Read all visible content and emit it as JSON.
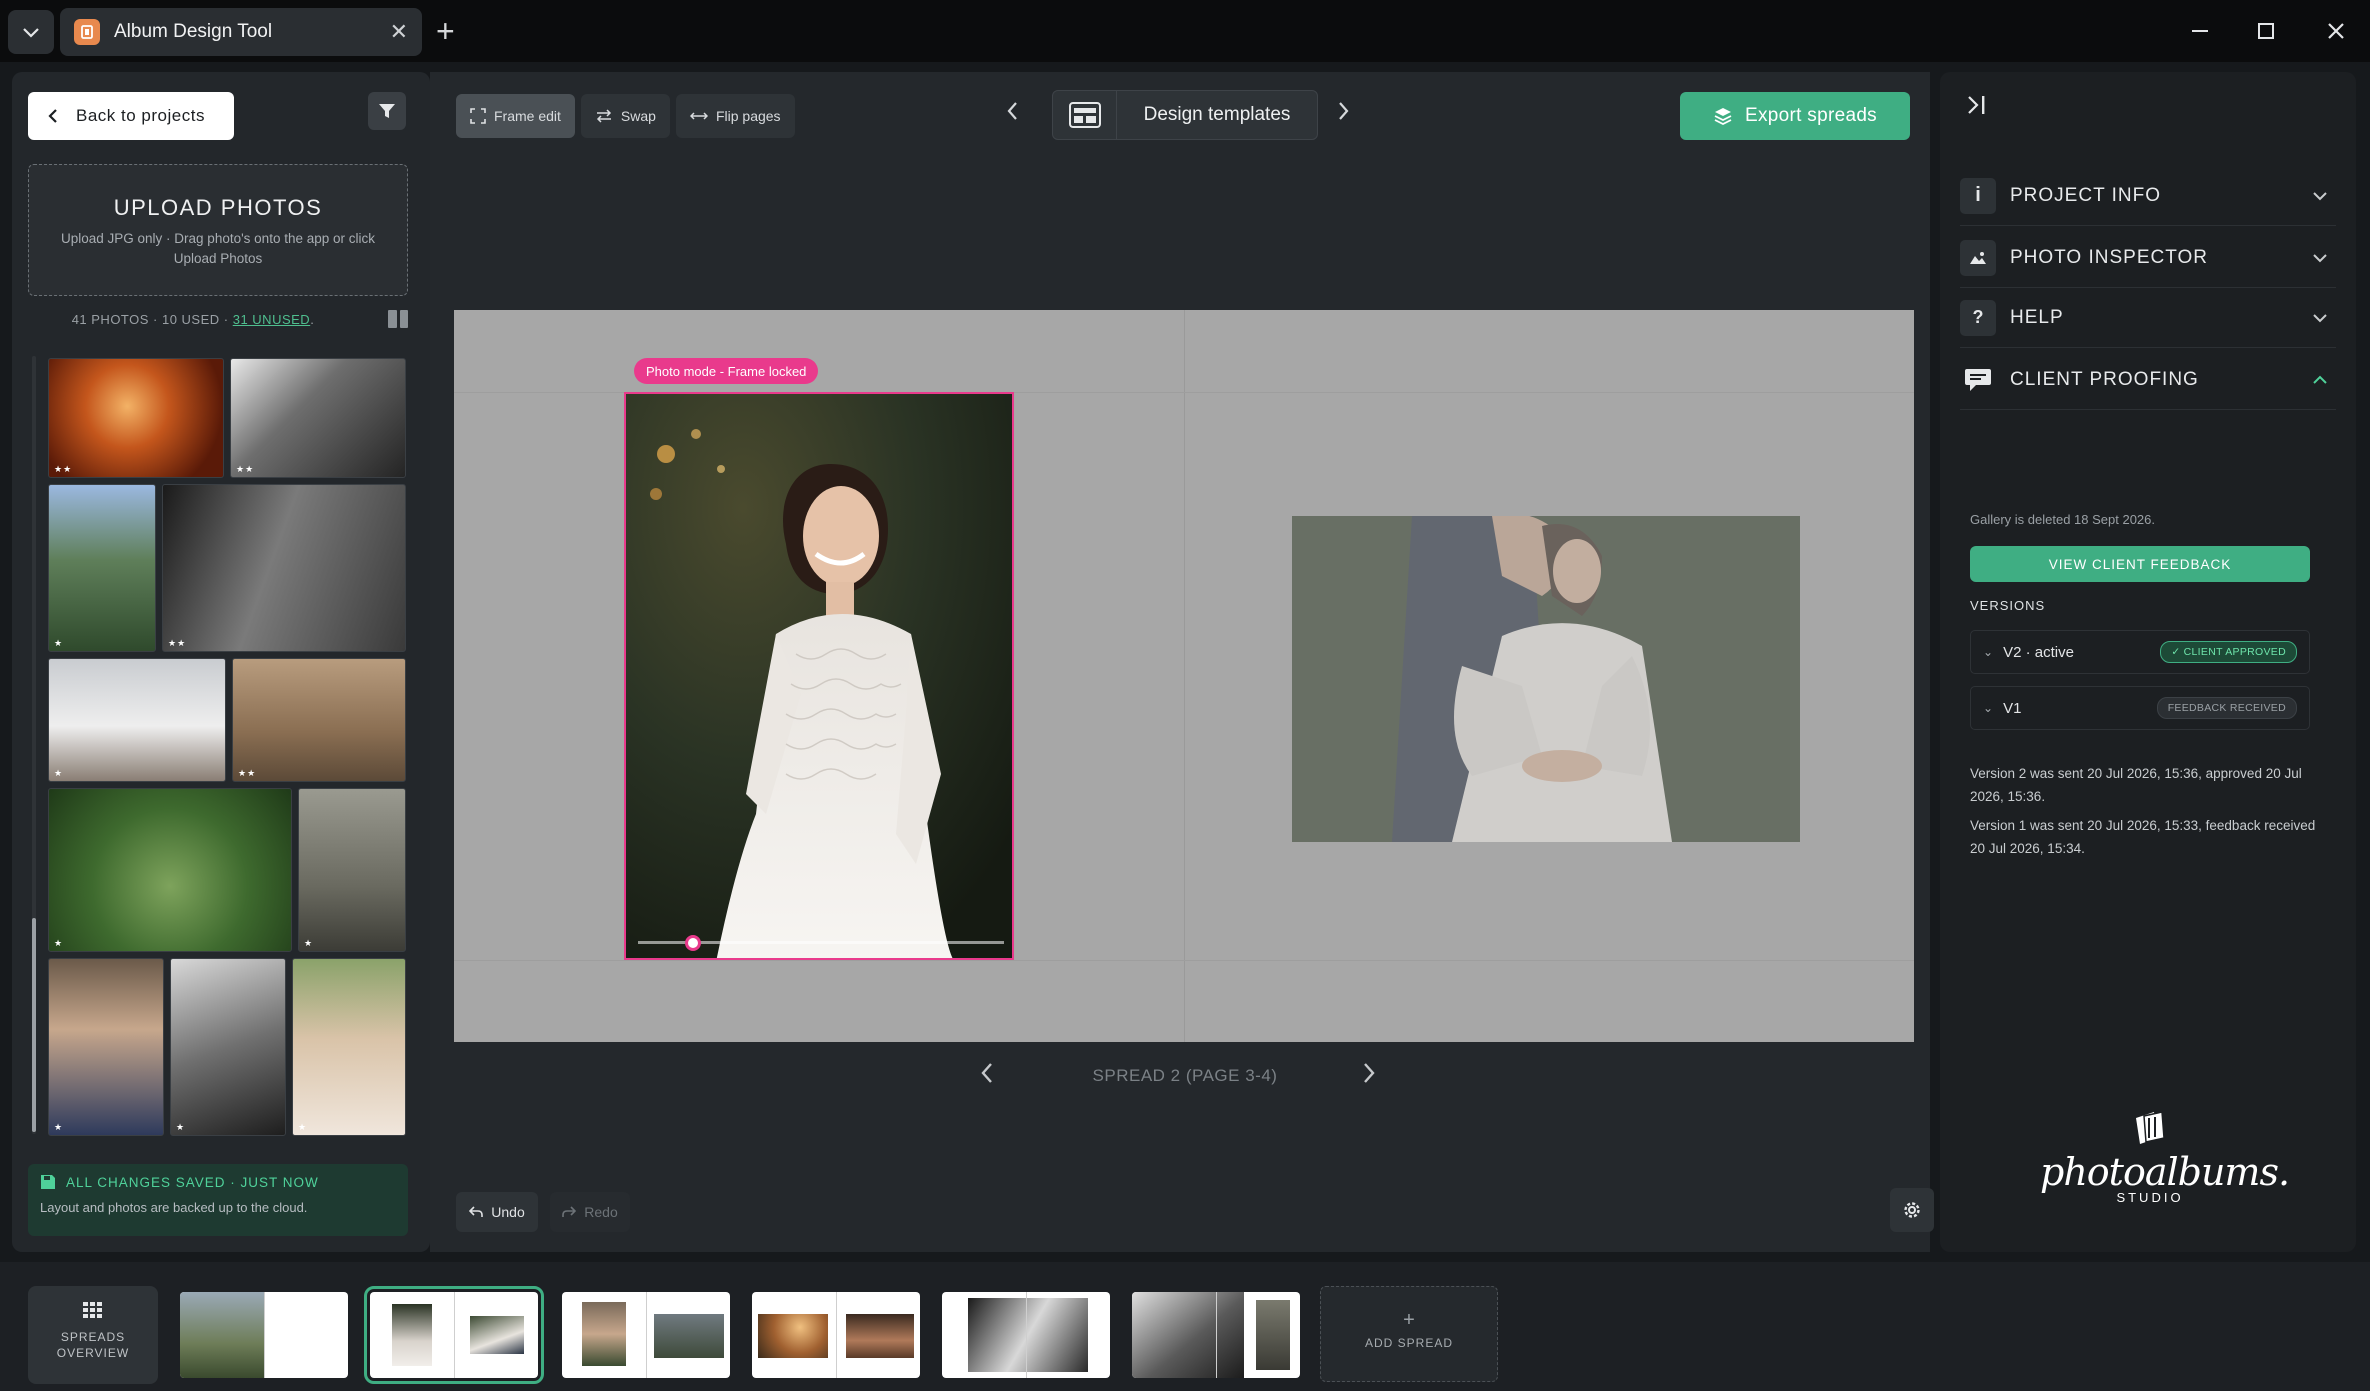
{
  "window": {
    "tab_title": "Album Design Tool"
  },
  "left_panel": {
    "back_label": "Back to projects",
    "upload_title": "UPLOAD PHOTOS",
    "upload_sub": "Upload JPG only · Drag photo's onto the app or click Upload Photos",
    "counts_prefix": "41 PHOTOS · 10 USED · ",
    "counts_unused": "31 UNUSED",
    "counts_suffix": ".",
    "photos": [
      {
        "stars": "★★"
      },
      {
        "stars": "★★"
      },
      {
        "stars": "★"
      },
      {
        "stars": "★★"
      },
      {
        "stars": "★"
      },
      {
        "stars": "★★"
      },
      {
        "stars": "★"
      },
      {
        "stars": "★"
      },
      {
        "stars": "★"
      },
      {
        "stars": "★"
      },
      {
        "stars": "★"
      }
    ],
    "saved_title": "ALL CHANGES SAVED · JUST NOW",
    "saved_sub": "Layout and photos are backed up to the cloud."
  },
  "toolbar": {
    "frame_edit": "Frame edit",
    "swap": "Swap",
    "flip_pages": "Flip pages",
    "design_templates": "Design templates",
    "export": "Export spreads"
  },
  "canvas": {
    "mode_badge": "Photo mode - Frame locked",
    "zoom_level": 0.15,
    "spread_label": "SPREAD 2 (PAGE 3-4)",
    "undo": "Undo",
    "redo": "Redo"
  },
  "right_panel": {
    "sections": [
      {
        "label": "PROJECT INFO",
        "icon": "info-icon"
      },
      {
        "label": "PHOTO INSPECTOR",
        "icon": "image-icon"
      },
      {
        "label": "HELP",
        "icon": "question-icon"
      },
      {
        "label": "CLIENT PROOFING",
        "icon": "chat-icon"
      }
    ],
    "deleted_note": "Gallery is deleted 18 Sept 2026.",
    "view_feedback": "VIEW CLIENT FEEDBACK",
    "versions_label": "VERSIONS",
    "versions": [
      {
        "label": "V2 · active",
        "badge": "✓ CLIENT APPROVED"
      },
      {
        "label": "V1",
        "badge": "FEEDBACK RECEIVED"
      }
    ],
    "note_v2": "Version 2 was sent 20 Jul 2026, 15:36, approved 20 Jul 2026, 15:36.",
    "note_v1": "Version 1 was sent 20 Jul 2026, 15:33, feedback received 20 Jul 2026, 15:34.",
    "logo_script": "photoalbums.",
    "logo_sub": "STUDIO"
  },
  "bottom_bar": {
    "overview_line1": "SPREADS",
    "overview_line2": "OVERVIEW",
    "add_spread": "ADD SPREAD",
    "add_plus": "+"
  },
  "colors": {
    "accent_green": "#3fae83",
    "badge_pink": "#e93a8c"
  }
}
